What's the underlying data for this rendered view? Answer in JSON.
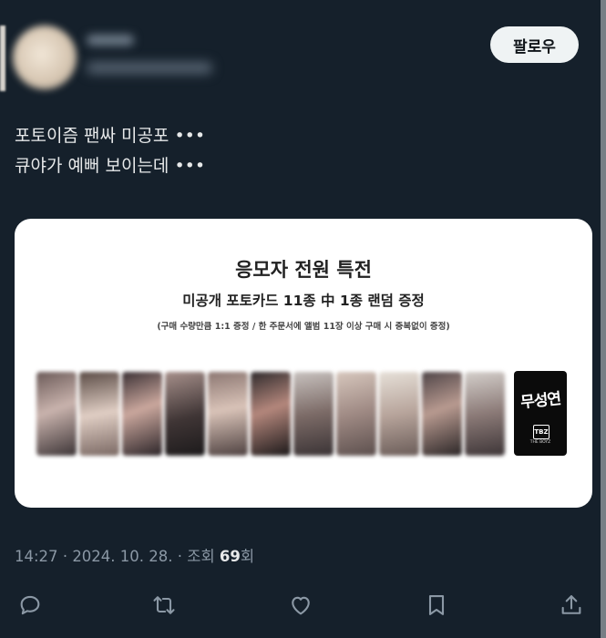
{
  "author": {
    "follow_label": "팔로우"
  },
  "tweet": {
    "lines": [
      "포토이즘 팬싸 미공포 •••",
      "큐야가 예뻐 보이는데 •••"
    ]
  },
  "card": {
    "title": "응모자 전원 특전",
    "subtitle": "미공개 포토카드 11종 中 1종 랜덤 증정",
    "note": "(구매 수량만큼 1:1 증정 / 한 주문서에 앨범 11장 이상 구매 시 중복없이 증정)",
    "photocard_count": 11,
    "album_logo": "무성연",
    "album_mark": "TBZ",
    "album_text": "THE BOYZ"
  },
  "meta": {
    "time": "14:27",
    "sep": "·",
    "date": "2024. 10. 28.",
    "views_label": "조회",
    "views_count": "69",
    "views_suffix": "회"
  },
  "actions": {
    "reply": "reply-icon",
    "retweet": "retweet-icon",
    "like": "heart-icon",
    "bookmark": "bookmark-icon",
    "share": "share-icon"
  },
  "colors": {
    "background": "#15202b",
    "text": "#e7e9ea",
    "secondary": "#8b98a5"
  }
}
